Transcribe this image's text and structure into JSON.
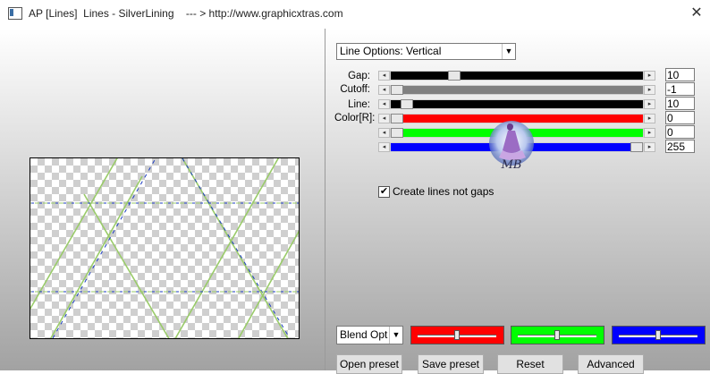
{
  "window": {
    "title": "AP [Lines]  Lines - SilverLining    --- > http://www.graphicxtras.com",
    "close_glyph": "✕",
    "icon": "app-window-icon"
  },
  "line_options": {
    "selected": "Line Options: Vertical"
  },
  "sliders": [
    {
      "label": "Gap:",
      "value": "10",
      "color": "#000000",
      "position": 0.24
    },
    {
      "label": "Cutoff:",
      "value": "-1",
      "color": "#808080",
      "position": 0.0
    },
    {
      "label": "Line:",
      "value": "10",
      "color": "#000000",
      "position": 0.04
    },
    {
      "label": "Color[R]:",
      "value": "0",
      "color": "#ff0000",
      "position": 0.0
    },
    {
      "label": "",
      "value": "0",
      "color": "#00ff00",
      "position": 0.0
    },
    {
      "label": "",
      "value": "255",
      "color": "#0000ff",
      "position": 1.0
    }
  ],
  "checkbox": {
    "label": "Create lines not gaps",
    "checked": true,
    "glyph": "✔"
  },
  "logo": {
    "text": "MB",
    "icon": "watermark-logo"
  },
  "blend": {
    "selected": "Blend Optio"
  },
  "blend_channels": [
    {
      "color": "#ff0000",
      "position": 0.5
    },
    {
      "color": "#00ff00",
      "position": 0.5
    },
    {
      "color": "#0000ff",
      "position": 0.5
    }
  ],
  "buttons": {
    "open_preset": "Open preset",
    "save_preset": "Save preset",
    "reset": "Reset",
    "advanced": "Advanced"
  },
  "arrows": {
    "left": "◂",
    "right": "▸",
    "dropdown": "▼"
  }
}
